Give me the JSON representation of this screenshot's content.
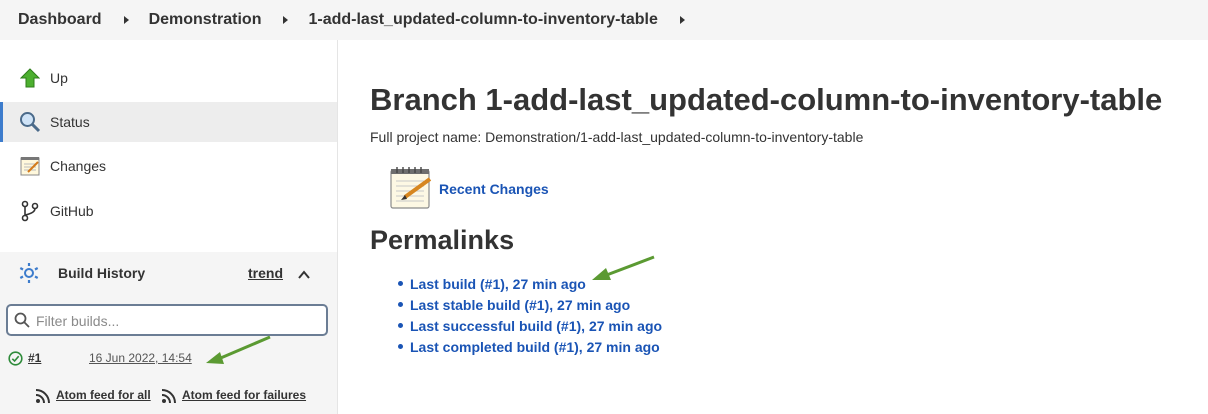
{
  "breadcrumb": {
    "items": [
      "Dashboard",
      "Demonstration",
      "1-add-last_updated-column-to-inventory-table"
    ]
  },
  "sidebar": {
    "items": [
      {
        "label": "Up",
        "icon": "up-arrow-icon"
      },
      {
        "label": "Status",
        "icon": "magnifier-icon"
      },
      {
        "label": "Changes",
        "icon": "notepad-icon"
      },
      {
        "label": "GitHub",
        "icon": "branch-icon"
      }
    ]
  },
  "build_history": {
    "title": "Build History",
    "trend_label": "trend",
    "filter_placeholder": "Filter builds...",
    "builds": [
      {
        "number": "#1",
        "date": "16 Jun 2022, 14:54",
        "status": "success"
      }
    ],
    "feed_all": "Atom feed for all",
    "feed_failures": "Atom feed for failures"
  },
  "main": {
    "title": "Branch 1-add-last_updated-column-to-inventory-table",
    "full_project_name": "Full project name: Demonstration/1-add-last_updated-column-to-inventory-table",
    "recent_changes": "Recent Changes",
    "permalinks_heading": "Permalinks",
    "permalinks": [
      "Last build (#1), 27 min ago",
      "Last stable build (#1), 27 min ago",
      "Last successful build (#1), 27 min ago",
      "Last completed build (#1), 27 min ago"
    ]
  },
  "colors": {
    "link": "#1a54b5",
    "annotation_arrow": "#5b9a32",
    "active_indicator": "#3d7ccc"
  }
}
